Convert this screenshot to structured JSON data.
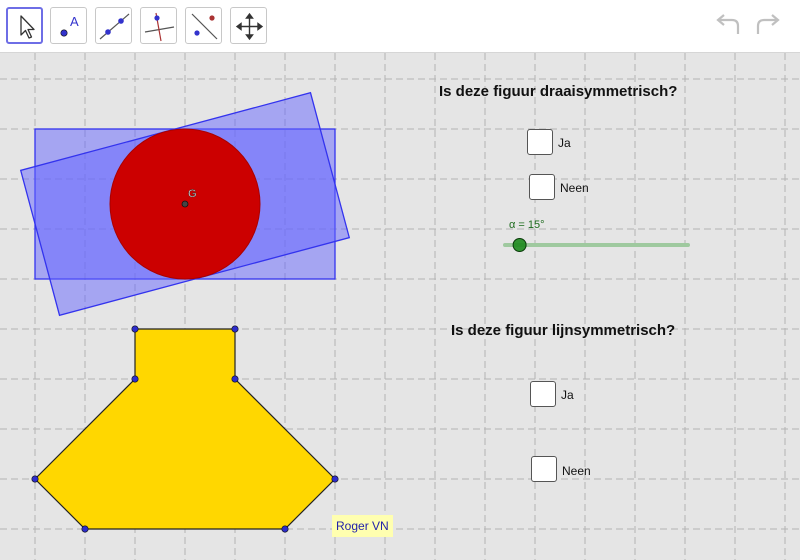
{
  "toolbar": {
    "tools": [
      {
        "name": "move-tool",
        "icon": "arrow-cursor-icon"
      },
      {
        "name": "point-tool",
        "icon": "point-icon",
        "glyph": "A"
      },
      {
        "name": "line-tool",
        "icon": "line-through-two-points-icon"
      },
      {
        "name": "perpendicular-line-tool",
        "icon": "perpendicular-line-icon"
      },
      {
        "name": "reflect-tool",
        "icon": "reflect-about-line-icon"
      },
      {
        "name": "move-graphics-view-tool",
        "icon": "move-arrows-icon"
      }
    ],
    "undo_icon": "undo-icon",
    "redo_icon": "redo-icon"
  },
  "colors": {
    "accent": "#6e6ee6",
    "rectangle_fill": "#6666ff",
    "circle_fill": "#cc0000",
    "polygon_fill": "#ffd700",
    "point": "#2222aa",
    "slider": "#1c8a1c"
  },
  "section1": {
    "question": "Is deze figuur draaisymmetrisch?",
    "checkbox_ja": "Ja",
    "checkbox_neen": "Neen",
    "slider_label": "α = 15°",
    "slider_value": 15,
    "slider_fraction": 0.08
  },
  "section2": {
    "question": "Is deze figuur lijnsymmetrisch?",
    "checkbox_ja": "Ja",
    "checkbox_neen": "Neen"
  },
  "figure": {
    "center_point_label": "G"
  },
  "author": "Roger VN"
}
